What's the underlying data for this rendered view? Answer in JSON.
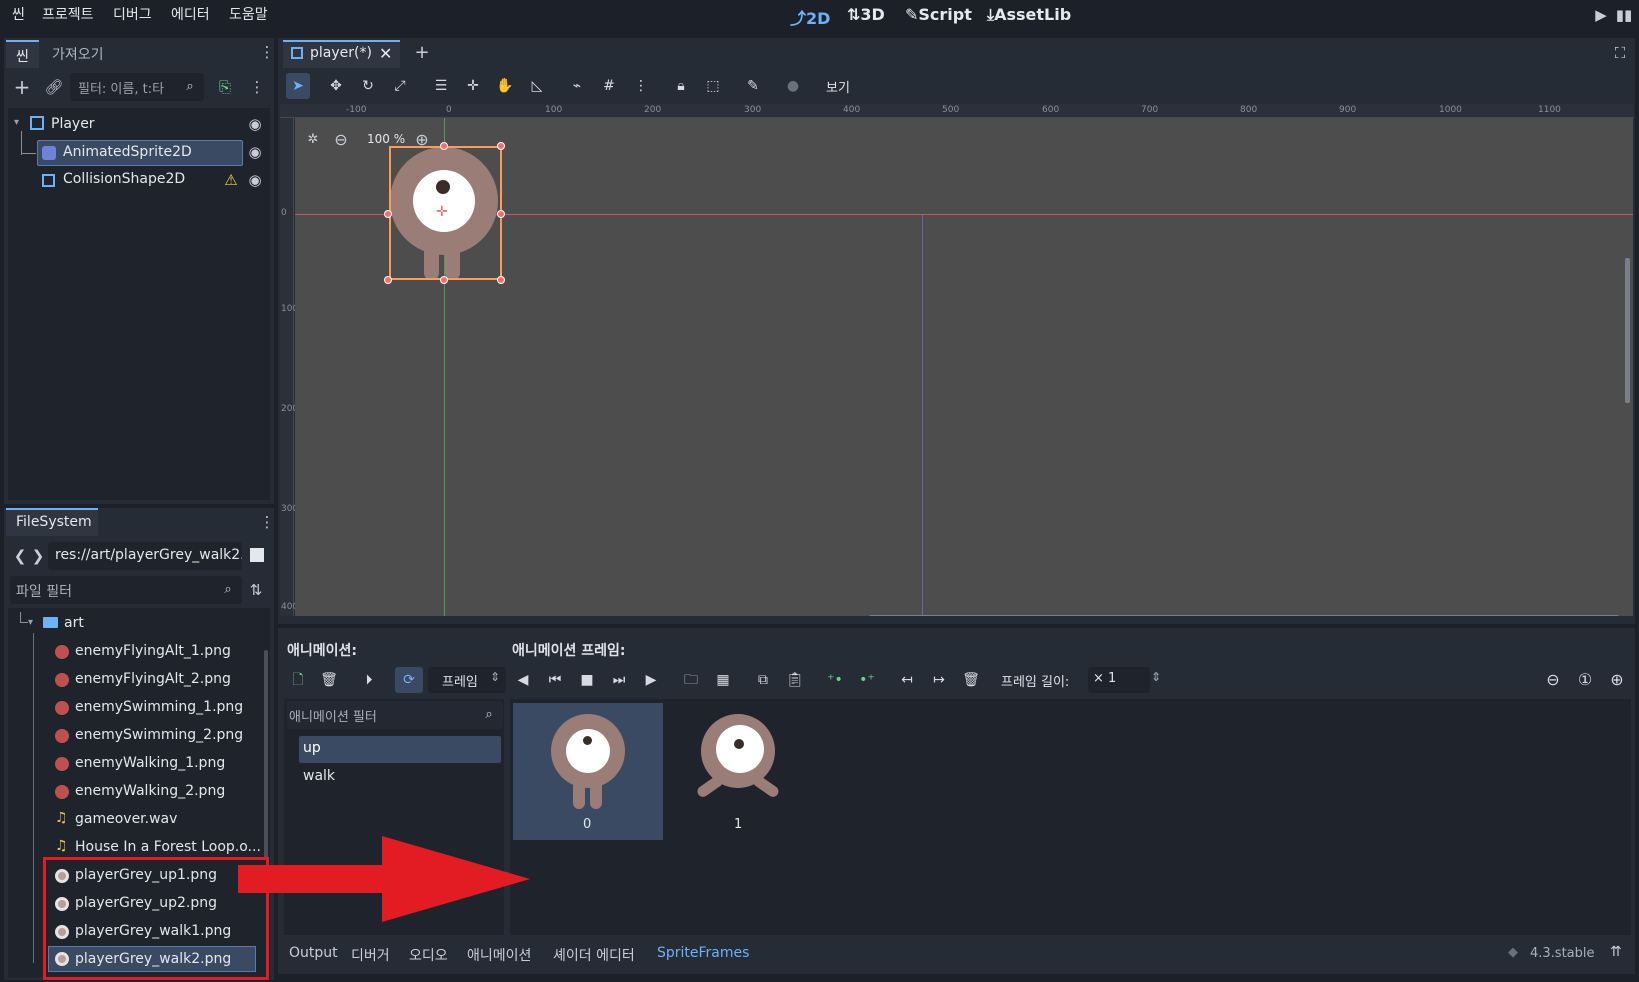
{
  "menubar": {
    "items": [
      "씬",
      "프로젝트",
      "디버그",
      "에디터",
      "도움말"
    ],
    "workspaces": [
      "2D",
      "3D",
      "Script",
      "AssetLib"
    ],
    "active_workspace": "2D"
  },
  "scene_dock": {
    "tabs": [
      "씬",
      "가져오기"
    ],
    "filter_placeholder": "필터: 이름, t:타",
    "tree": [
      {
        "label": "Player",
        "icon": "node2d-icon"
      },
      {
        "label": "AnimatedSprite2D",
        "icon": "animated-sprite-icon",
        "selected": true
      },
      {
        "label": "CollisionShape2D",
        "icon": "collision-shape-icon",
        "warning": true
      }
    ]
  },
  "filesystem": {
    "tab": "FileSystem",
    "path": "res://art/playerGrey_walk2.",
    "filter_placeholder": "파일 필터",
    "folder": "art",
    "files": [
      {
        "name": "enemyFlyingAlt_1.png",
        "color": "#c0504d"
      },
      {
        "name": "enemyFlyingAlt_2.png",
        "color": "#c0504d"
      },
      {
        "name": "enemySwimming_1.png",
        "color": "#c0504d"
      },
      {
        "name": "enemySwimming_2.png",
        "color": "#c0504d"
      },
      {
        "name": "enemyWalking_1.png",
        "color": "#c0504d"
      },
      {
        "name": "enemyWalking_2.png",
        "color": "#c0504d"
      },
      {
        "name": "gameover.wav",
        "color": "#f0c24a"
      },
      {
        "name": "House In a Forest Loop.o...",
        "color": "#f0c24a"
      },
      {
        "name": "playerGrey_up1.png",
        "color": "#b79e98"
      },
      {
        "name": "playerGrey_up2.png",
        "color": "#b79e98"
      },
      {
        "name": "playerGrey_walk1.png",
        "color": "#b79e98"
      },
      {
        "name": "playerGrey_walk2.png",
        "color": "#b79e98",
        "selected": true
      }
    ]
  },
  "editor": {
    "scene_tab": "player(*)",
    "view_label": "보기",
    "zoom": "100 %",
    "ruler_x": [
      "-100",
      "0",
      "100",
      "200",
      "300",
      "400",
      "500",
      "600",
      "700",
      "800",
      "900",
      "1000",
      "1100"
    ],
    "ruler_y": [
      "0",
      "100",
      "200",
      "300",
      "400"
    ]
  },
  "animation_panel": {
    "animations_title": "애니메이션:",
    "frames_title": "애니메이션 프레임:",
    "mode": "프레임",
    "filter_placeholder": "애니메이션 필터",
    "animations": [
      "up",
      "walk"
    ],
    "selected_animation": "up",
    "frame_length_label": "프레임 길이:",
    "frame_length_value": "× 1",
    "frames": [
      "0",
      "1"
    ]
  },
  "bottom_tabs": [
    "Output",
    "디버거",
    "오디오",
    "애니메이션",
    "셰이더 에디터",
    "SpriteFrames"
  ],
  "active_bottom_tab": "SpriteFrames",
  "version": "4.3.stable",
  "colors": {
    "accent": "#6db2f7",
    "annotation_red": "#e31c23",
    "selection": "#3b4a63",
    "viewport_bg": "#4d4d4d",
    "character": "#9b7d78"
  }
}
